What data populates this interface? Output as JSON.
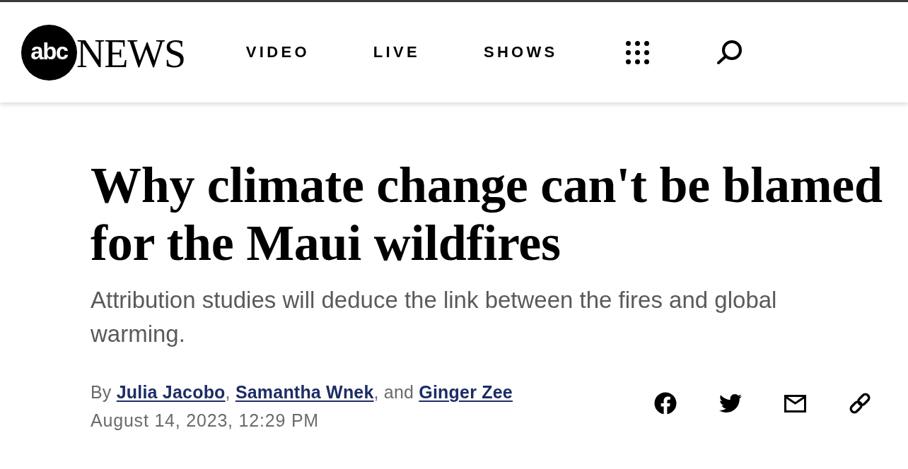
{
  "header": {
    "logo": {
      "mark": "abc",
      "wordmark": "NEWS"
    },
    "nav": [
      {
        "label": "VIDEO"
      },
      {
        "label": "LIVE"
      },
      {
        "label": "SHOWS"
      }
    ]
  },
  "article": {
    "headline": "Why climate change can't be blamed for the Maui wildfires",
    "subheadline": "Attribution studies will deduce the link between the fires and global warming.",
    "byline": [
      {
        "kind": "text",
        "text": "By "
      },
      {
        "kind": "link",
        "text": "Julia Jacobo"
      },
      {
        "kind": "text",
        "text": ", "
      },
      {
        "kind": "link",
        "text": "Samantha Wnek"
      },
      {
        "kind": "text",
        "text": ", and "
      },
      {
        "kind": "link",
        "text": "Ginger Zee"
      }
    ],
    "timestamp": "August 14, 2023, 12:29 PM"
  }
}
